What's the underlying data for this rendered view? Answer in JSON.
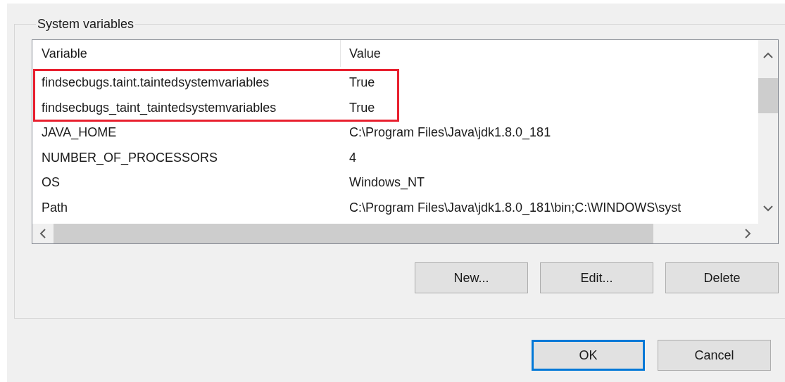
{
  "group": {
    "title": "System variables"
  },
  "table": {
    "columns": [
      "Variable",
      "Value"
    ],
    "rows": [
      {
        "variable": "findsecbugs.taint.taintedsystemvariables",
        "value": "True",
        "highlighted": true
      },
      {
        "variable": "findsecbugs_taint_taintedsystemvariables",
        "value": "True",
        "highlighted": true
      },
      {
        "variable": "JAVA_HOME",
        "value": "C:\\Program Files\\Java\\jdk1.8.0_181",
        "highlighted": false
      },
      {
        "variable": "NUMBER_OF_PROCESSORS",
        "value": "4",
        "highlighted": false
      },
      {
        "variable": "OS",
        "value": "Windows_NT",
        "highlighted": false
      },
      {
        "variable": "Path",
        "value": "C:\\Program Files\\Java\\jdk1.8.0_181\\bin;C:\\WINDOWS\\syst",
        "highlighted": false
      }
    ]
  },
  "row_buttons": [
    {
      "label": "New..."
    },
    {
      "label": "Edit..."
    },
    {
      "label": "Delete"
    }
  ],
  "dialog_buttons": [
    {
      "label": "OK",
      "default": true
    },
    {
      "label": "Cancel",
      "default": false
    }
  ]
}
